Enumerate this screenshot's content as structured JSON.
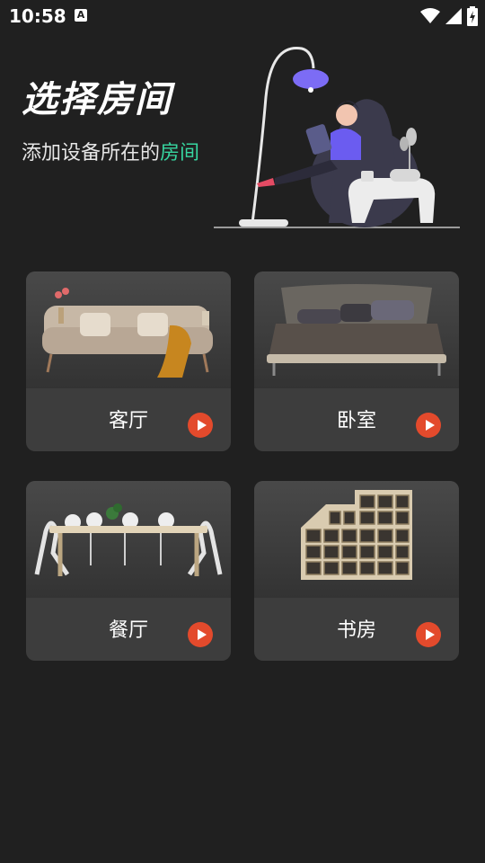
{
  "status": {
    "time": "10:58",
    "notif_icon": "A"
  },
  "header": {
    "title": "选择房间",
    "subtitle_prefix": "添加设备所在的",
    "subtitle_highlight": "房间"
  },
  "colors": {
    "accent": "#37d6a0",
    "play": "#e34a2c",
    "card": "#3d3d3d",
    "background": "#202020"
  },
  "rooms": [
    {
      "label": "客厅",
      "icon": "play-icon"
    },
    {
      "label": "卧室",
      "icon": "play-icon"
    },
    {
      "label": "餐厅",
      "icon": "play-icon"
    },
    {
      "label": "书房",
      "icon": "play-icon"
    }
  ]
}
